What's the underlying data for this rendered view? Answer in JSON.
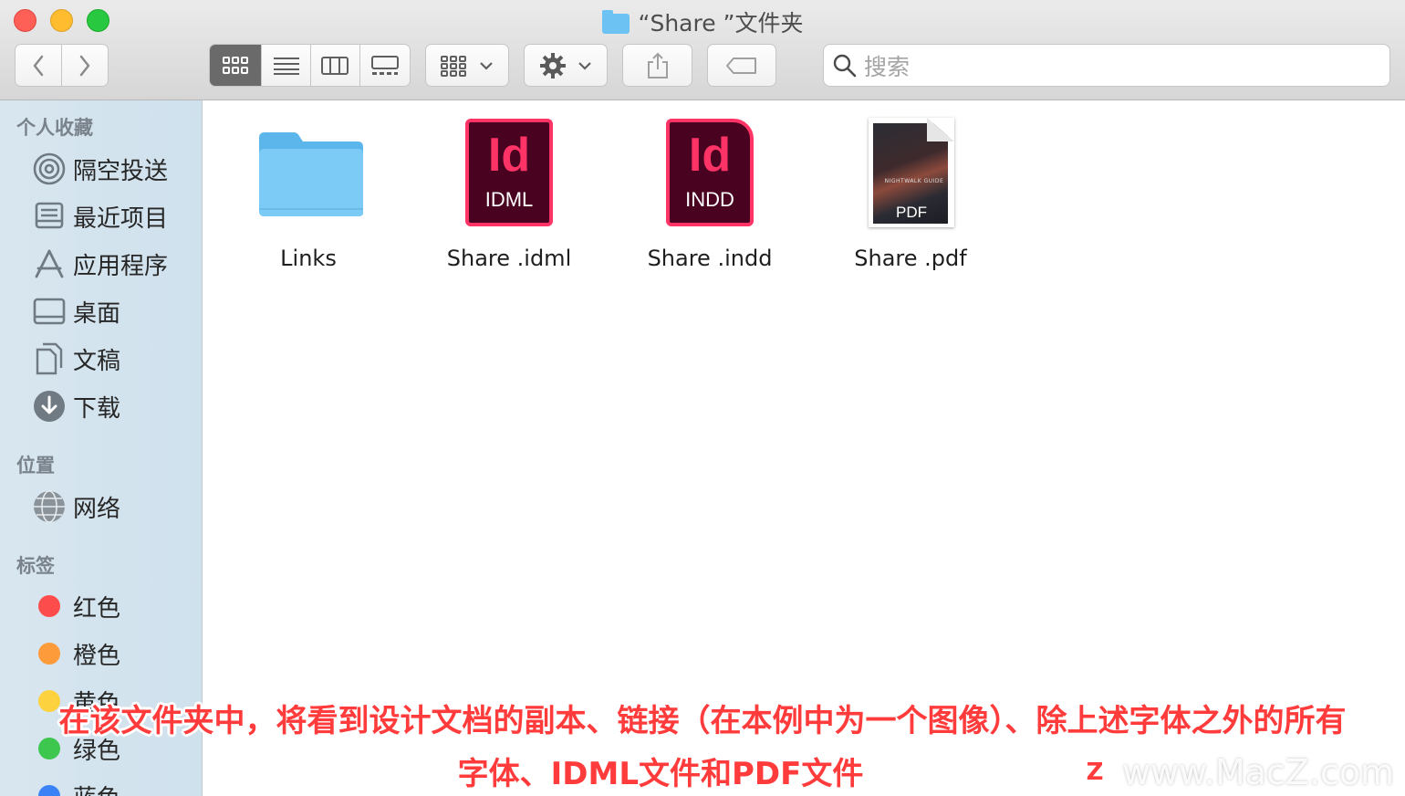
{
  "window": {
    "title": "“Share ”文件夹"
  },
  "toolbar": {
    "back_icon": "chevron-left-icon",
    "forward_icon": "chevron-right-icon",
    "view_modes": [
      "icon-view",
      "list-view",
      "column-view",
      "gallery-view"
    ],
    "active_view": "icon-view",
    "search_placeholder": "搜索"
  },
  "sidebar": {
    "favorites_title": "个人收藏",
    "favorites": [
      {
        "label": "隔空投送",
        "icon": "airdrop-icon"
      },
      {
        "label": "最近项目",
        "icon": "recents-icon"
      },
      {
        "label": "应用程序",
        "icon": "applications-icon"
      },
      {
        "label": "桌面",
        "icon": "desktop-icon"
      },
      {
        "label": "文稿",
        "icon": "documents-icon"
      },
      {
        "label": "下载",
        "icon": "downloads-icon"
      }
    ],
    "locations_title": "位置",
    "locations": [
      {
        "label": "网络",
        "icon": "network-icon"
      }
    ],
    "tags_title": "标签",
    "tags": [
      {
        "label": "红色",
        "color": "#fc4d4c"
      },
      {
        "label": "橙色",
        "color": "#fd9a3a"
      },
      {
        "label": "黄色",
        "color": "#fdd23f"
      },
      {
        "label": "绿色",
        "color": "#3dc74f"
      },
      {
        "label": "蓝色",
        "color": "#3a82f6"
      }
    ]
  },
  "files": [
    {
      "name": "Links",
      "type": "folder"
    },
    {
      "name": "Share .idml",
      "type": "idml",
      "badge": "Id",
      "ext": "IDML"
    },
    {
      "name": "Share .indd",
      "type": "indd",
      "badge": "Id",
      "ext": "INDD"
    },
    {
      "name": "Share .pdf",
      "type": "pdf",
      "ext": "PDF",
      "cover_text": "NIGHTWALK GUIDE"
    }
  ],
  "caption": {
    "line1": "在该文件夹中，将看到设计文档的副本、链接（在本例中为一个图像）、除上述字体之外的所有",
    "line2": "字体、IDML文件和PDF文件"
  },
  "watermark": {
    "logo": "Z",
    "text": "www.MacZ.com"
  }
}
